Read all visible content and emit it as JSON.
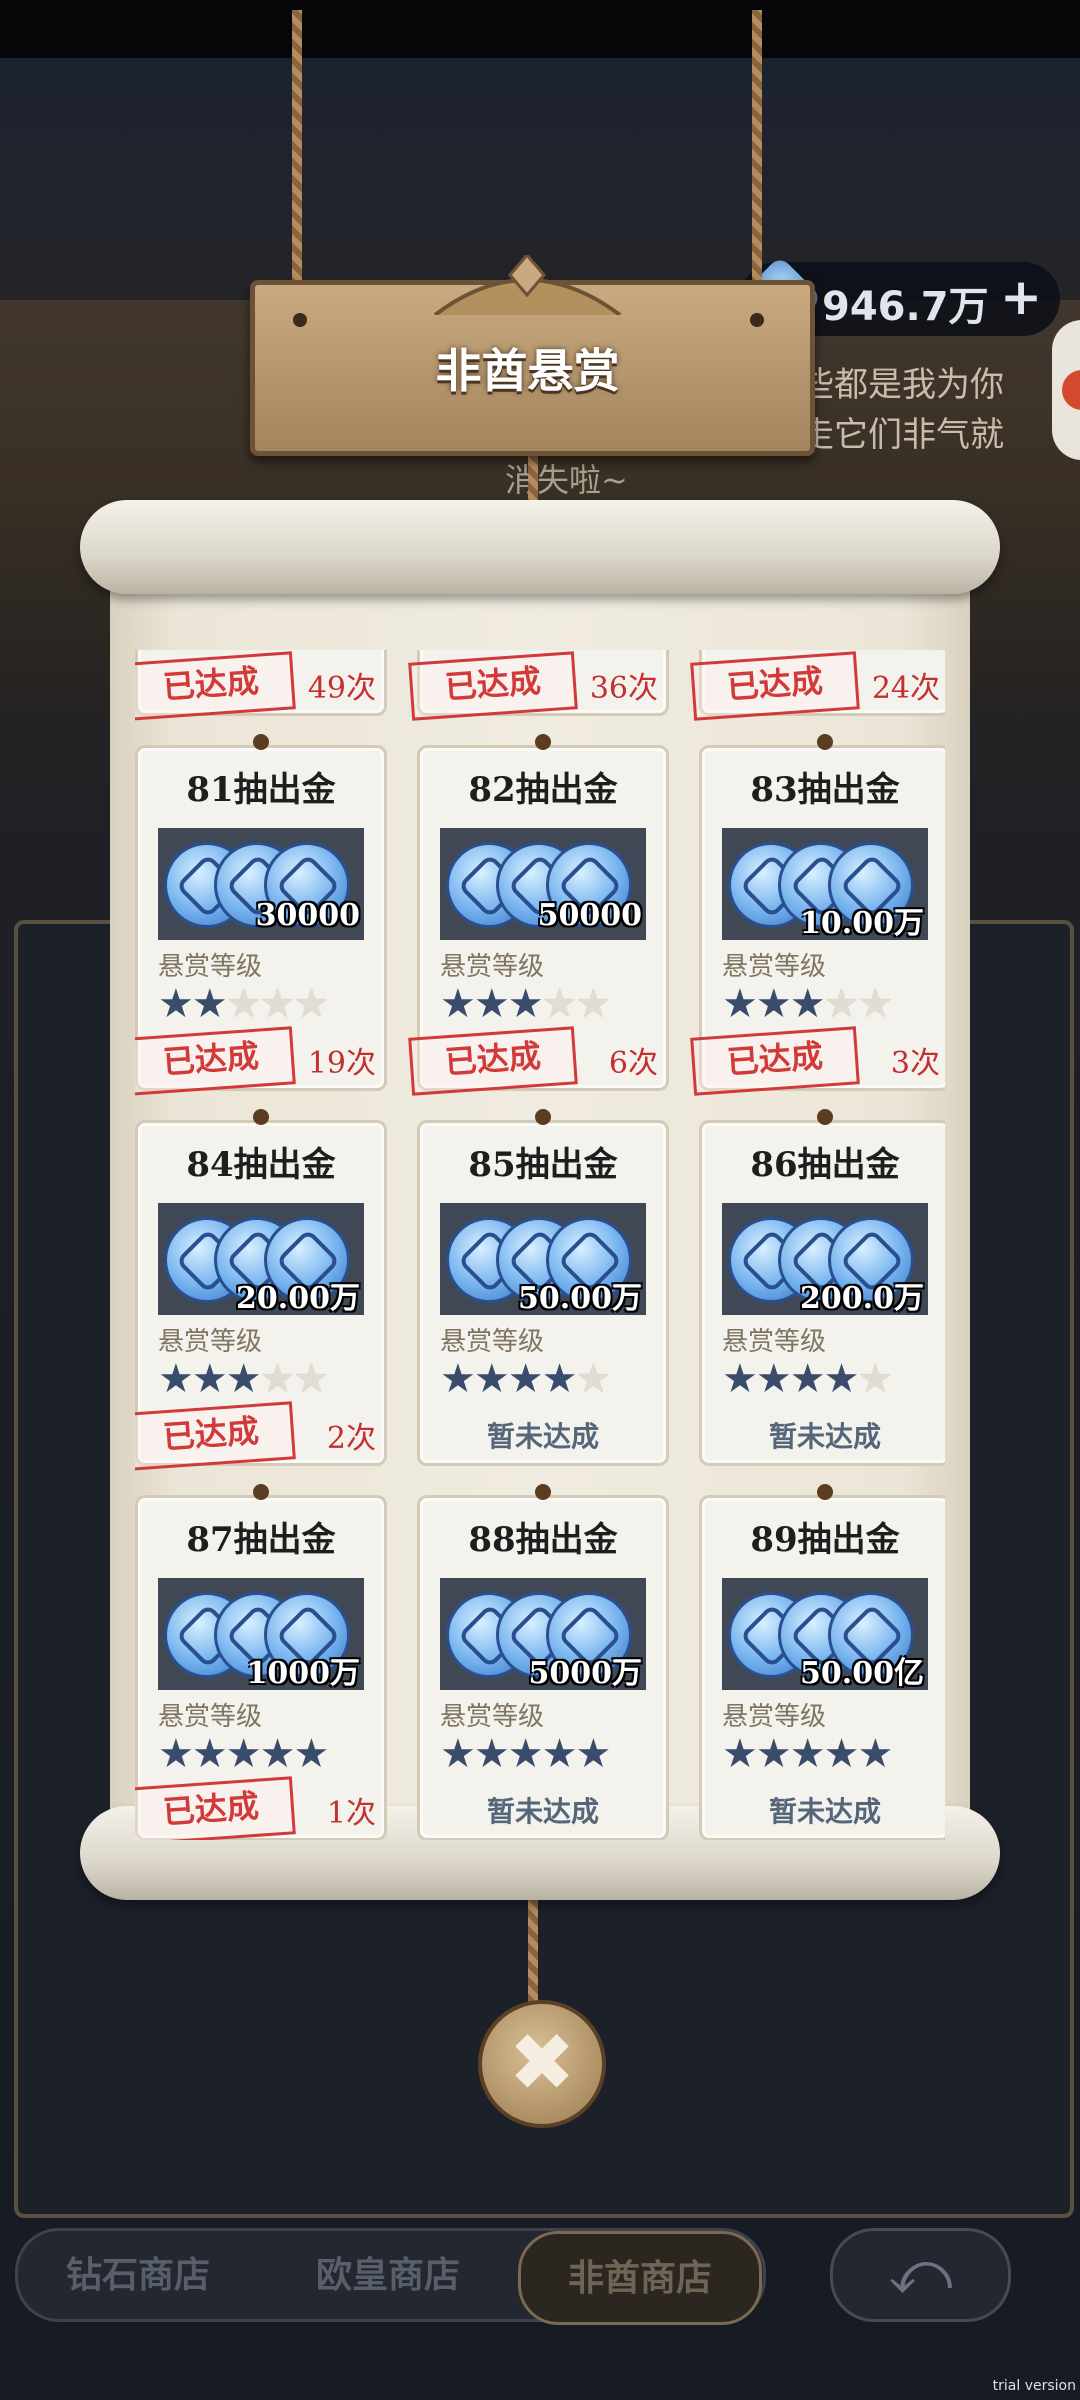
{
  "currency": {
    "amount": "946.7万",
    "plus": "+"
  },
  "npc": {
    "speech_line1": "些都是我为你",
    "speech_line2": "走它们非气就",
    "speech_line3": "消失啦~"
  },
  "sign": {
    "title": "非酋悬赏"
  },
  "level_label": "悬赏等级",
  "achieved_label": "已达成",
  "pending_label": "暂未达成",
  "top_row": [
    {
      "times": "49次"
    },
    {
      "times": "36次"
    },
    {
      "times": "24次"
    }
  ],
  "cards": [
    {
      "title": "81抽出金",
      "amount": "30000",
      "stars": 2,
      "achieved": true,
      "times": "19次"
    },
    {
      "title": "82抽出金",
      "amount": "50000",
      "stars": 3,
      "achieved": true,
      "times": "6次"
    },
    {
      "title": "83抽出金",
      "amount": "10.00万",
      "stars": 3,
      "achieved": true,
      "times": "3次"
    },
    {
      "title": "84抽出金",
      "amount": "20.00万",
      "stars": 3,
      "achieved": true,
      "times": "2次"
    },
    {
      "title": "85抽出金",
      "amount": "50.00万",
      "stars": 4,
      "achieved": false,
      "times": ""
    },
    {
      "title": "86抽出金",
      "amount": "200.0万",
      "stars": 4,
      "achieved": false,
      "times": ""
    },
    {
      "title": "87抽出金",
      "amount": "1000万",
      "stars": 5,
      "achieved": true,
      "times": "1次"
    },
    {
      "title": "88抽出金",
      "amount": "5000万",
      "stars": 5,
      "achieved": false,
      "times": ""
    },
    {
      "title": "89抽出金",
      "amount": "50.00亿",
      "stars": 5,
      "achieved": false,
      "times": ""
    }
  ],
  "close_icon": "close-x-icon",
  "tabs": [
    {
      "label": "钻石商店",
      "active": false
    },
    {
      "label": "欧皇商店",
      "active": false
    },
    {
      "label": "非酋商店",
      "active": true
    }
  ],
  "back_icon": "back-arrow-icon",
  "watermark": "trial version",
  "colors": {
    "star_on": "#3a4c6c",
    "stamp_red": "#d23a3a",
    "paper": "#f0ebe0"
  }
}
